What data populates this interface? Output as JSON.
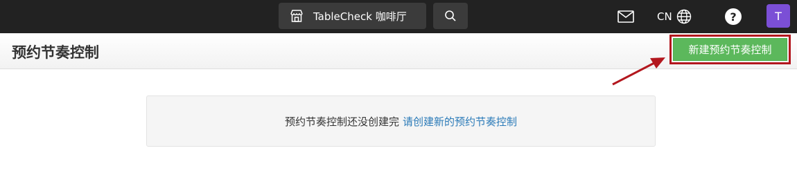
{
  "topbar": {
    "venue_name": "TableCheck 咖啡厅",
    "language": "CN",
    "avatar_initial": "T",
    "help_glyph": "?",
    "icons": {
      "venue": "storefront-icon",
      "search": "search-icon",
      "mail": "mail-icon",
      "language": "globe-icon"
    }
  },
  "page": {
    "title": "预约节奏控制",
    "new_button_label": "新建预约节奏控制"
  },
  "empty_state": {
    "message": "预约节奏控制还没创建完",
    "link_text": "请创建新的预约节奏控制"
  },
  "colors": {
    "topbar_bg": "#222222",
    "button_dark": "#3b3b3b",
    "avatar": "#7b4fd6",
    "primary_green": "#5cb85c",
    "highlight_red": "#b3171e",
    "link_blue": "#2a7ab8"
  }
}
